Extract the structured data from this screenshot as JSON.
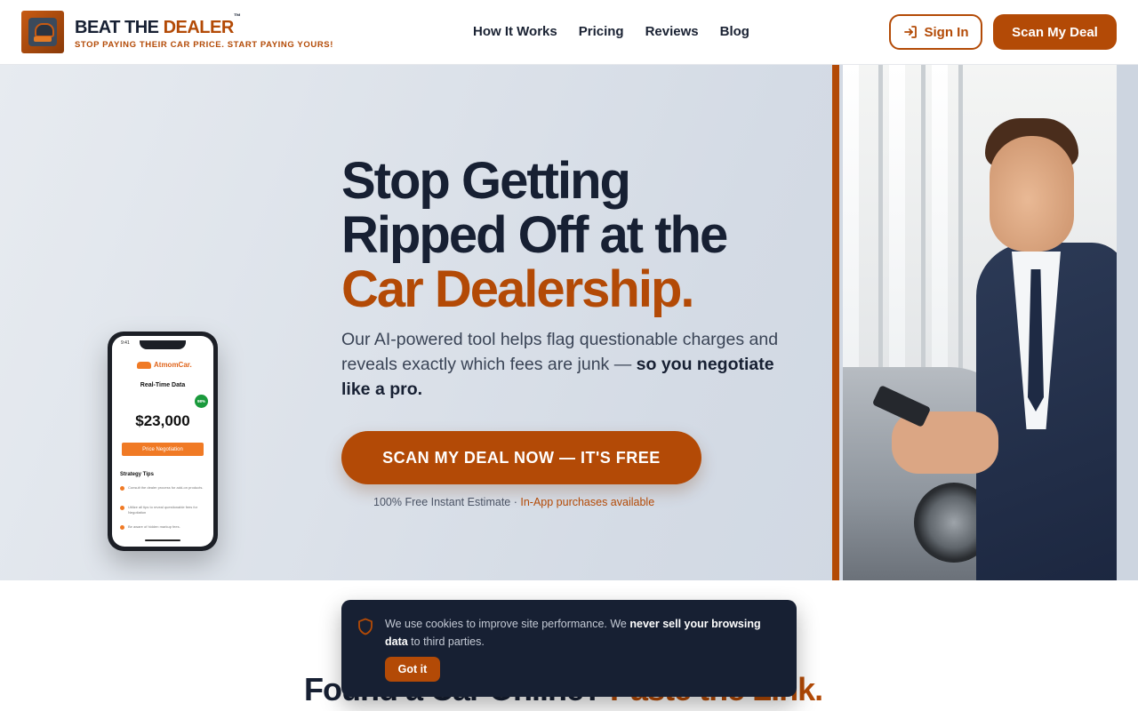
{
  "header": {
    "brand_part1": "BEAT THE ",
    "brand_part2": "DEALER",
    "brand_tm": "™",
    "tagline": "STOP PAYING THEIR CAR PRICE. START PAYING YOURS!",
    "nav": [
      "How It Works",
      "Pricing",
      "Reviews",
      "Blog"
    ],
    "sign_in_label": "Sign In",
    "scan_label": "Scan My Deal"
  },
  "hero": {
    "title_line1": "Stop Getting",
    "title_line2": "Ripped Off at the",
    "title_line3": "Car Dealership.",
    "subtitle_plain": "Our AI-powered tool helps flag questionable charges and reveals exactly which fees are junk — ",
    "subtitle_bold": "so you negotiate like a pro.",
    "cta_label": "SCAN MY DEAL NOW — IT'S FREE",
    "note_plain": "100% Free Instant Estimate · ",
    "note_highlight": "In-App purchases available"
  },
  "phone": {
    "status_time": "9:41",
    "app_name": "AtmomCar.",
    "section_title": "Real-Time Data",
    "badge": "98%",
    "price": "$23,000",
    "button_label": "Price Negotiation",
    "tips_title": "Strategy Tips",
    "tips": [
      "Consult the dealer process for add-on products.",
      "Utilize all tips to reveal questionable fees for Negotiation",
      "Be aware of hidden markup fees."
    ]
  },
  "lower": {
    "title_plain": "Found a Car Online? ",
    "title_accent": "Paste the Link."
  },
  "cookie": {
    "text_plain": "We use cookies to improve site performance. We ",
    "text_bold": "never sell your browsing data",
    "text_end": " to third parties.",
    "button_label": "Got it"
  },
  "colors": {
    "accent": "#b34a06",
    "navy": "#172033",
    "hero_bg": "#d4dbe5"
  },
  "icons": {
    "logo": "car-dealer-logo-icon",
    "sign_in": "sign-in-arrow-icon",
    "cookie": "shield-icon"
  }
}
